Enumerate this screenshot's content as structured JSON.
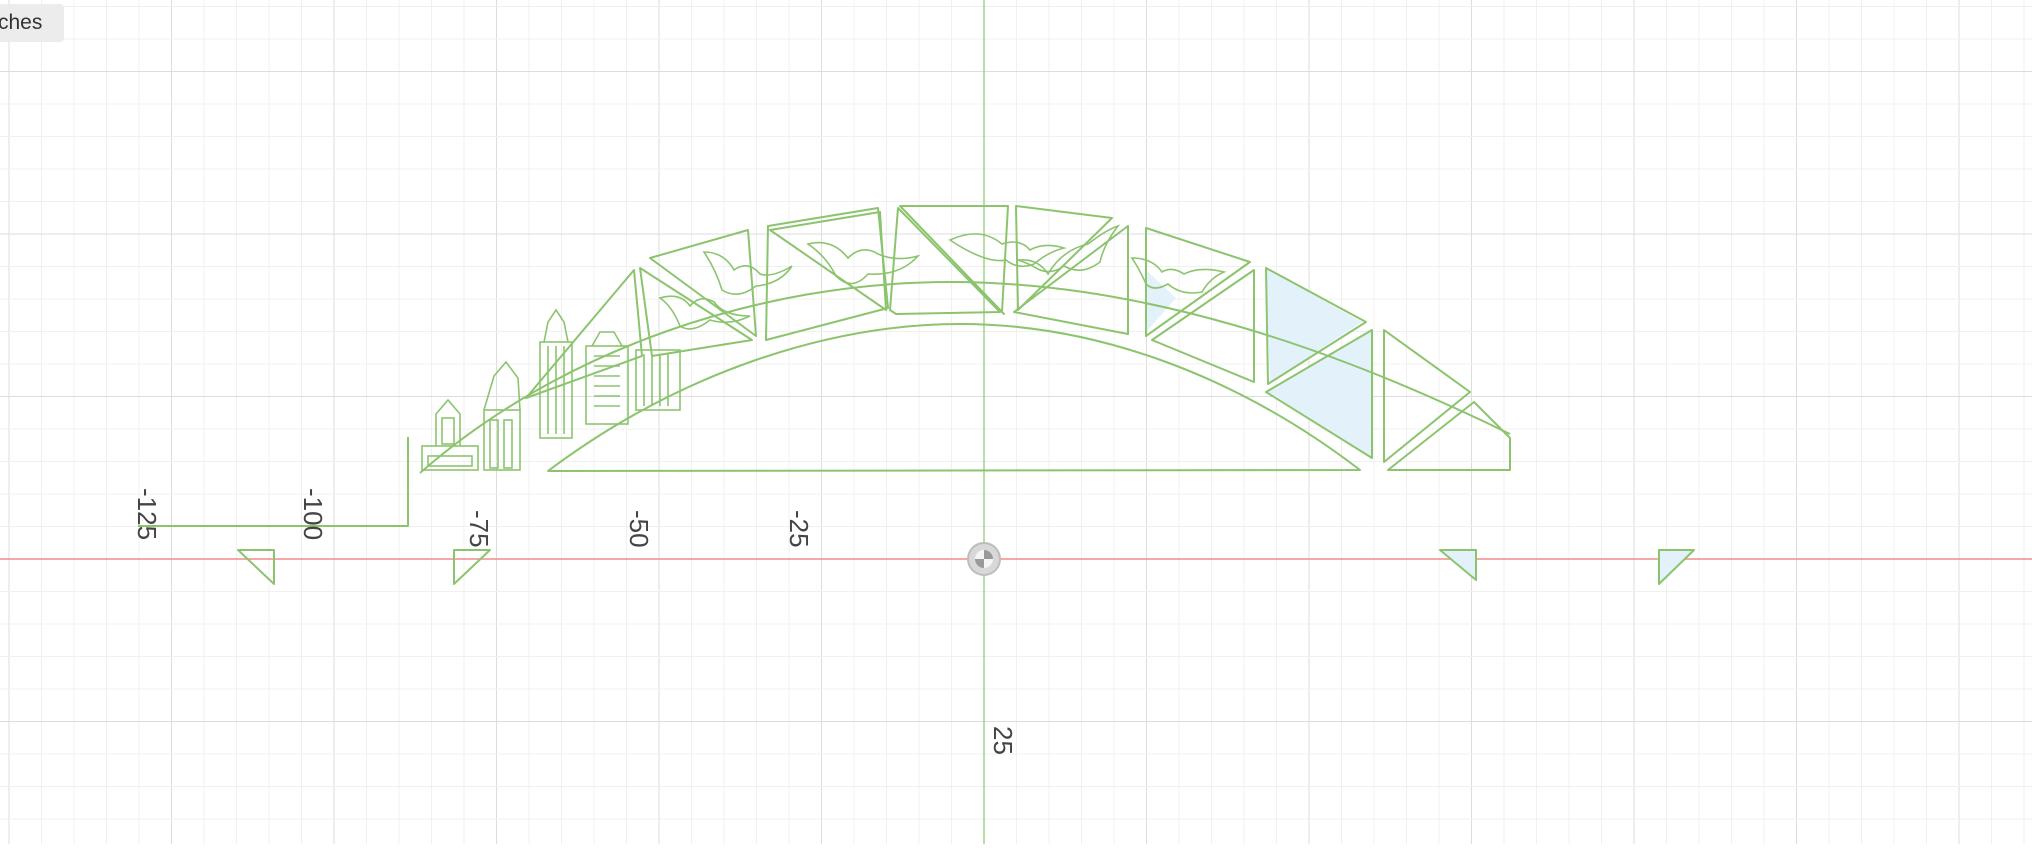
{
  "browser_tab": {
    "label": "ches"
  },
  "canvas": {
    "background": "#ffffff",
    "grid_minor_color": "#f0f0f0",
    "grid_major_color": "#dddddd",
    "x_axis_color": "#f08c8c",
    "y_axis_color": "#9fd38a",
    "sketch_color": "#8cc46e",
    "fill_color": "#e3f1fb"
  },
  "axis_labels": {
    "x": [
      "-125",
      "-100",
      "-75",
      "-50",
      "-25"
    ],
    "y": [
      "25"
    ]
  },
  "origin": {
    "icon": "origin-marker-icon"
  }
}
